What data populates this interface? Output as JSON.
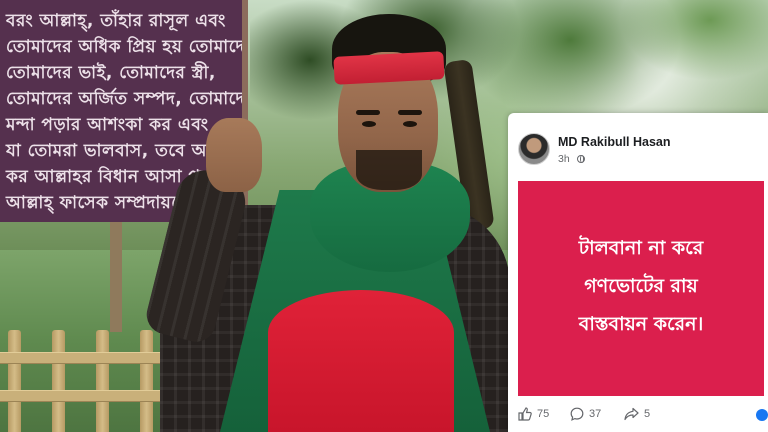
{
  "signboard": {
    "lines": [
      "বরং আল্লাহ্, তাঁহার রাসূল এবং",
      "তোমাদের অধিক প্রিয় হয় তোমাদের",
      "তোমাদের ভাই, তোমাদের স্ত্রী,",
      "তোমাদের অর্জিত সম্পদ, তোমাদের",
      "মন্দা পড়ার আশংকা কর এবং",
      "যা তোমরা ভালবাস, তবে অপেক্ষা",
      "কর আল্লাহর বিধান আসা পর্যন্ত",
      "আল্লাহ্ ফাসেক সম্প্রদায়কে পথ"
    ]
  },
  "post": {
    "author": "MD Rakibull Hasan",
    "time": "3h",
    "privacy_icon": "globe-icon",
    "text_lines": [
      "টালবানা না করে",
      "গণভোটের রায়",
      "বাস্তবায়ন করেন।"
    ],
    "background_color": "#db1f4d",
    "reactions": {
      "likes": "75",
      "comments": "37",
      "shares": "5"
    }
  }
}
